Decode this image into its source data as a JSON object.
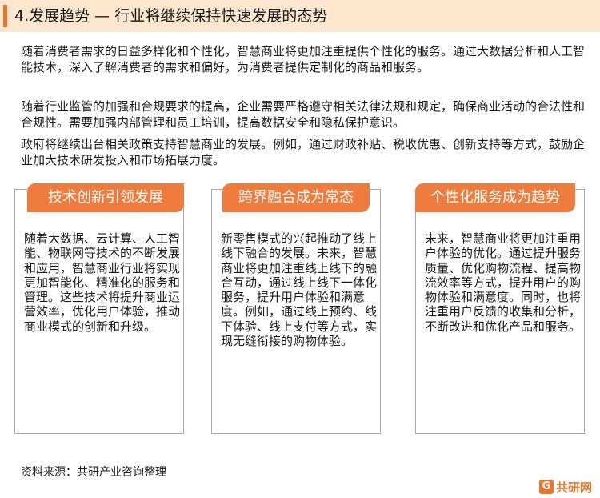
{
  "header": {
    "title": "4.发展趋势 — 行业将继续保持快速发展的态势"
  },
  "intro_paragraphs": [
    "随着消费者需求的日益多样化和个性化，智慧商业将更加注重提供个性化的服务。通过大数据分析和人工智能技术，深入了解消费者的需求和偏好，为消费者提供定制化的商品和服务。",
    "随着行业监管的加强和合规要求的提高，企业需要严格遵守相关法律法规和规定，确保商业活动的合法性和合规性。需要加强内部管理和员工培训，提高数据安全和隐私保护意识。",
    "政府将继续出台相关政策支持智慧商业的发展。例如，通过财政补贴、税收优惠、创新支持等方式，鼓励企业加大技术研发投入和市场拓展力度。"
  ],
  "cards": [
    {
      "title": "技术创新引领发展",
      "body": "随着大数据、云计算、人工智能、物联网等技术的不断发展和应用，智慧商业行业将实现更加智能化、精准化的服务和管理。这些技术将提升商业运营效率，优化用户体验，推动商业模式的创新和升级。"
    },
    {
      "title": "跨界融合成为常态",
      "body": "新零售模式的兴起推动了线上线下融合的发展。未来，智慧商业将更加注重线上线下的融合互动，通过线上线下一体化服务，提升用户体验和满意度。例如，通过线上预约、线下体验、线上支付等方式，实现无缝衔接的购物体验。"
    },
    {
      "title": "个性化服务成为趋势",
      "body": "未来，智慧商业将更加注重用户体验的优化。通过提升服务质量、优化购物流程、提高物流效率等方式，提升用户的购物体验和满意度。同时，也将注重用户反馈的收集和分析，不断改进和优化产品和服务。"
    }
  ],
  "source": "资料来源：共研产业咨询整理",
  "logo": {
    "mark": "G",
    "text": "共研网"
  },
  "colors": {
    "accent": "#e8772e",
    "card_header": "#ef7c3c",
    "header_bg": "#fde7cf"
  }
}
